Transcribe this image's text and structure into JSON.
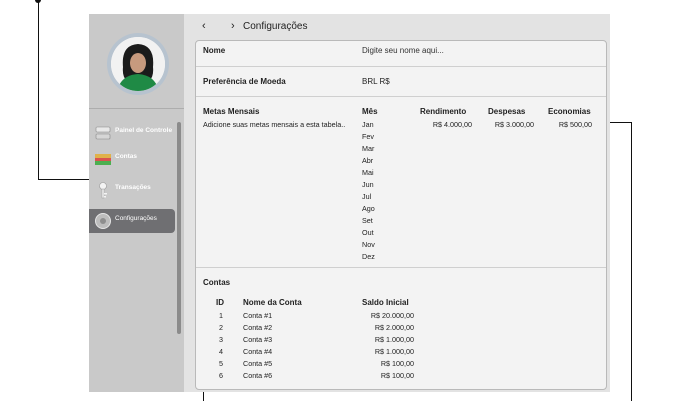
{
  "header": {
    "back_icon": "‹",
    "forward_icon": "›",
    "title": "Configurações"
  },
  "sidebar": {
    "items": [
      {
        "label": "Painel de Controle",
        "icon": "dashboard-icon"
      },
      {
        "label": "Contas",
        "icon": "wallet-icon"
      },
      {
        "label": "Transações",
        "icon": "key-icon"
      },
      {
        "label": "Configurações",
        "icon": "gear-icon",
        "active": true
      }
    ]
  },
  "settings": {
    "name_label": "Nome",
    "name_placeholder": "Digite seu nome aqui...",
    "currency_label": "Preferência de Moeda",
    "currency_value": "BRL R$",
    "goals": {
      "label": "Metas Mensais",
      "hint": "Adicione suas metas mensais a esta tabela..",
      "month_header": "Mês",
      "income_header": "Rendimento",
      "expense_header": "Despesas",
      "savings_header": "Economias",
      "months": [
        "Jan",
        "Fev",
        "Mar",
        "Abr",
        "Mai",
        "Jun",
        "Jul",
        "Ago",
        "Set",
        "Out",
        "Nov",
        "Dez"
      ],
      "first_row": {
        "income": "R$ 4.000,00",
        "expenses": "R$ 3.000,00",
        "savings": "R$ 500,00"
      }
    },
    "accounts": {
      "label": "Contas",
      "columns": [
        "ID",
        "Nome da Conta",
        "Saldo Inicial"
      ],
      "rows": [
        {
          "id": "1",
          "name": "Conta #1",
          "balance": "R$ 20.000,00"
        },
        {
          "id": "2",
          "name": "Conta #2",
          "balance": "R$ 2.000,00"
        },
        {
          "id": "3",
          "name": "Conta #3",
          "balance": "R$ 1.000,00"
        },
        {
          "id": "4",
          "name": "Conta #4",
          "balance": "R$ 1.000,00"
        },
        {
          "id": "5",
          "name": "Conta #5",
          "balance": "R$ 100,00"
        },
        {
          "id": "6",
          "name": "Conta #6",
          "balance": "R$ 100,00"
        }
      ]
    }
  }
}
